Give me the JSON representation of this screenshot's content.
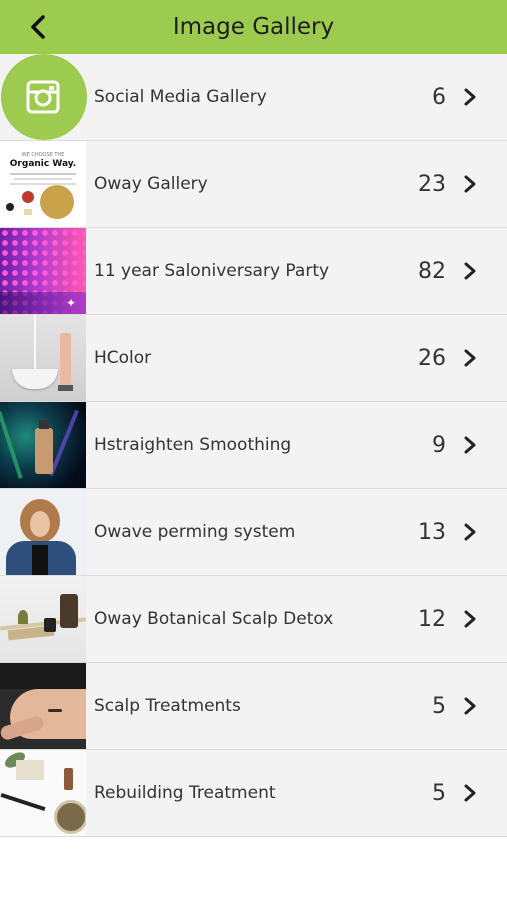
{
  "header": {
    "title": "Image Gallery",
    "back_icon": "chevron-left-icon",
    "bg_color": "#9dcb4f"
  },
  "galleries": [
    {
      "name": "Social Media Gallery",
      "count": "6",
      "thumb": "instagram-icon"
    },
    {
      "name": "Oway Gallery",
      "count": "23",
      "thumb": "Organic Way."
    },
    {
      "name": "11 year Saloniversary Party",
      "count": "82"
    },
    {
      "name": "HColor",
      "count": "26"
    },
    {
      "name": "Hstraighten Smoothing",
      "count": "9"
    },
    {
      "name": "Owave perming system",
      "count": "13"
    },
    {
      "name": "Oway Botanical Scalp Detox",
      "count": "12"
    },
    {
      "name": "Scalp Treatments",
      "count": "5"
    },
    {
      "name": "Rebuilding Treatment",
      "count": "5"
    }
  ],
  "chevron_icon": "chevron-right-icon"
}
